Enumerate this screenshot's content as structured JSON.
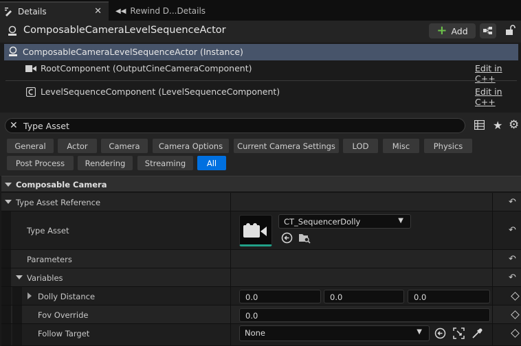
{
  "tabs": [
    {
      "label": "Details",
      "active": true
    },
    {
      "label": "Rewind D...Details",
      "active": false
    }
  ],
  "header": {
    "title": "ComposableCameraLevelSequenceActor",
    "add_label": "Add"
  },
  "components": {
    "instance": "ComposableCameraLevelSequenceActor (Instance)",
    "items": [
      {
        "label": "RootComponent (OutputCineCameraComponent)",
        "link": "Edit in C++"
      },
      {
        "label": "LevelSequenceComponent (LevelSequenceComponent)",
        "link": "Edit in C++"
      }
    ]
  },
  "search": {
    "value": "Type Asset"
  },
  "categories": [
    {
      "label": "General",
      "active": false
    },
    {
      "label": "Actor",
      "active": false
    },
    {
      "label": "Camera",
      "active": false
    },
    {
      "label": "Camera Options",
      "active": false
    },
    {
      "label": "Current Camera Settings",
      "active": false
    },
    {
      "label": "LOD",
      "active": false
    },
    {
      "label": "Misc",
      "active": false
    },
    {
      "label": "Physics",
      "active": false
    },
    {
      "label": "Post Process",
      "active": false
    },
    {
      "label": "Rendering",
      "active": false
    },
    {
      "label": "Streaming",
      "active": false
    },
    {
      "label": "All",
      "active": true
    }
  ],
  "properties": {
    "section": "Composable Camera",
    "type_asset_reference": "Type Asset Reference",
    "type_asset": {
      "label": "Type Asset",
      "value": "CT_SequencerDolly"
    },
    "parameters": "Parameters",
    "variables": "Variables",
    "dolly_distance": {
      "label": "Dolly Distance",
      "values": [
        "0.0",
        "0.0",
        "0.0"
      ]
    },
    "fov_override": {
      "label": "Fov Override",
      "value": "0.0"
    },
    "follow_target": {
      "label": "Follow Target",
      "value": "None"
    }
  },
  "colors": {
    "accent": "#0070e0",
    "selection": "#47546a",
    "add_green": "#6cc24a",
    "asset_teal": "#21a088"
  }
}
